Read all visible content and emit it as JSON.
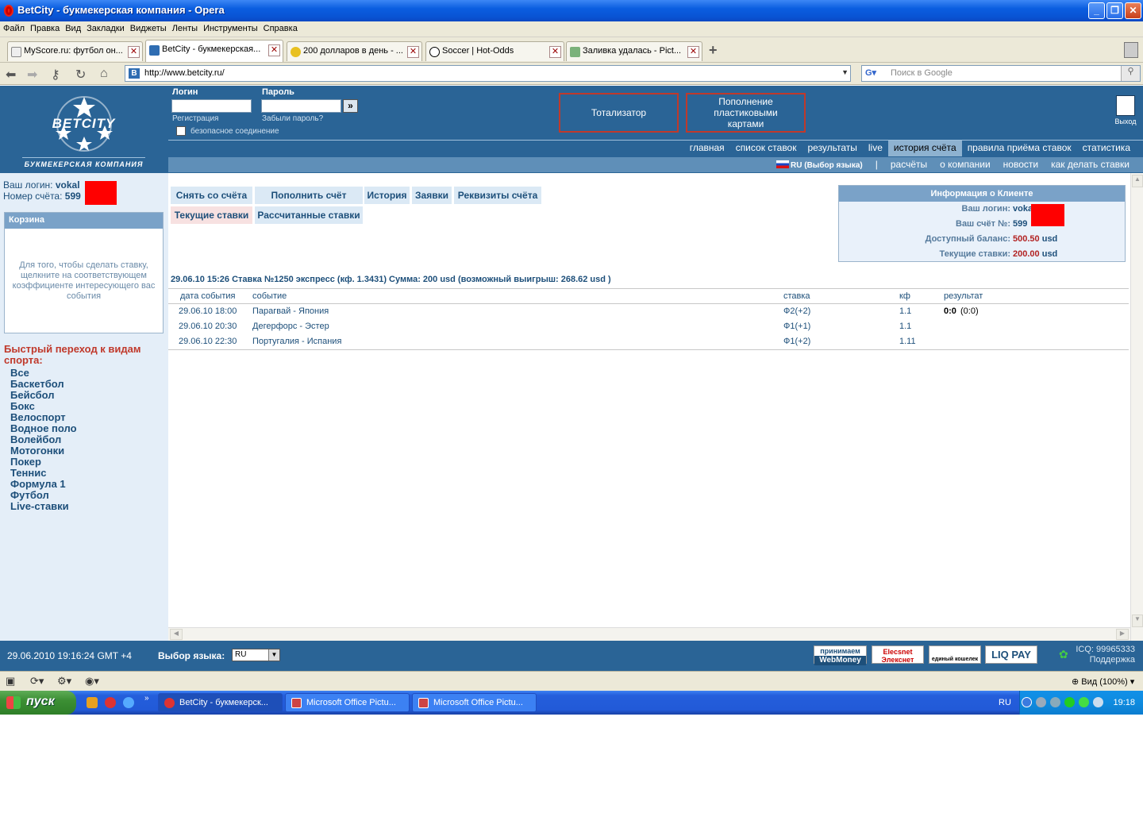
{
  "window": {
    "title": "BetCity - букмекерская компания - Opera"
  },
  "menu": [
    "Файл",
    "Правка",
    "Вид",
    "Закладки",
    "Виджеты",
    "Ленты",
    "Инструменты",
    "Справка"
  ],
  "tabs": [
    {
      "label": "MyScore.ru: футбол он..."
    },
    {
      "label": "BetCity - букмекерская..."
    },
    {
      "label": "200 долларов в день - ..."
    },
    {
      "label": "Soccer | Hot-Odds"
    },
    {
      "label": "Заливка удалась - Pict..."
    }
  ],
  "address": {
    "url": "http://www.betcity.ru/",
    "search_placeholder": "Поиск в Google"
  },
  "site": {
    "logo_text": "BETCITY",
    "logo_sub": "БУКМЕКЕРСКАЯ КОМПАНИЯ",
    "login_label": "Логин",
    "password_label": "Пароль",
    "register": "Регистрация",
    "forgot": "Забыли пароль?",
    "secure": "безопасное соединение",
    "go": "»",
    "totalizator": "Тотализатор",
    "topup_cards": "Пополнение пластиковыми картами",
    "exit": "Выход"
  },
  "nav": {
    "main": [
      "главная",
      "список ставок",
      "результаты",
      "live",
      "история счёта",
      "правила приёма ставок",
      "статистика"
    ],
    "active": "история счёта",
    "lang": "RU (Выбор языка)",
    "sub": [
      "расчёты",
      "о компании",
      "новости",
      "как делать ставки"
    ]
  },
  "sidebar": {
    "login_label": "Ваш логин:",
    "login_value": "vokal",
    "account_label": "Номер счёта:",
    "account_value": "599",
    "basket_title": "Корзина",
    "basket_text": "Для того, чтобы сделать ставку, щелкните на соответствующем коэффициенте интересующего вас события",
    "quick_title": "Быстрый переход к видам спорта:",
    "sports": [
      "Все",
      "Баскетбол",
      "Бейсбол",
      "Бокс",
      "Велоспорт",
      "Водное поло",
      "Волейбол",
      "Мотогонки",
      "Покер",
      "Теннис",
      "Формула 1",
      "Футбол",
      "Live-ставки"
    ]
  },
  "actions": {
    "withdraw": "Снять со счёта",
    "deposit": "Пополнить счёт",
    "history": "История",
    "requests": "Заявки",
    "requisites": "Реквизиты счёта",
    "current_bets": "Текущие ставки",
    "settled_bets": "Рассчитанные ставки"
  },
  "client": {
    "title": "Информация о Клиенте",
    "login_label": "Ваш логин:",
    "login_value": "vokal",
    "account_label": "Ваш счёт №:",
    "account_value": "599",
    "balance_label": "Доступный баланс:",
    "balance_value": "500.50",
    "current_label": "Текущие ставки:",
    "current_value": "200.00",
    "currency": "usd"
  },
  "bet": {
    "summary": "29.06.10 15:26  Ставка №1250  экспресс (кф. 1.3431)   Сумма: 200 usd (возможный выигрыш: 268.62 usd )",
    "headers": [
      "дата события",
      "событие",
      "ставка",
      "кф",
      "результат"
    ],
    "rows": [
      {
        "date": "29.06.10 18:00",
        "event": "Парагвай - Япония",
        "bet": "Ф2(+2)",
        "kf": "1.1",
        "score": "0:0",
        "score_extra": "(0:0)"
      },
      {
        "date": "29.06.10 20:30",
        "event": "Дегерфорс - Эстер",
        "bet": "Ф1(+1)",
        "kf": "1.1",
        "score": "",
        "score_extra": ""
      },
      {
        "date": "29.06.10 22:30",
        "event": "Португалия - Испания",
        "bet": "Ф1(+2)",
        "kf": "1.11",
        "score": "",
        "score_extra": ""
      }
    ]
  },
  "footer": {
    "datetime": "29.06.2010  19:16:24  GMT +4",
    "lang_label": "Выбор языка:",
    "lang_value": "RU",
    "webmoney_top": "принимаем",
    "webmoney": "WebMoney",
    "elecsnet": "Elecsnet Элекснет",
    "wallet": "единый кошелек",
    "liqpay": "LIQ PAY",
    "icq": "ICQ: 99965333",
    "support": "Поддержка"
  },
  "browser_bottom": {
    "zoom": "Вид (100%)"
  },
  "taskbar": {
    "start": "пуск",
    "tasks": [
      "BetCity - букмекерск...",
      "Microsoft Office Pictu...",
      "Microsoft Office Pictu..."
    ],
    "lang": "RU",
    "time": "19:18"
  },
  "colors": {
    "site_blue": "#2a6496",
    "accent_red": "#c0392b",
    "link": "#1d4f7a"
  }
}
